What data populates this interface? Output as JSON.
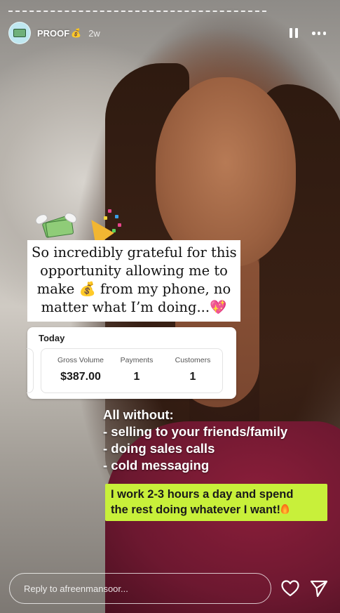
{
  "story": {
    "username": "PROOF",
    "username_emoji": "moneybag-emoji",
    "posted_ago": "2w"
  },
  "caption": {
    "lines": [
      "So incredibly grateful for this",
      "opportunity allowing me to",
      "make 💰 from my phone, no",
      "matter what I’m doing...💖"
    ]
  },
  "dashboard": {
    "title": "Today",
    "stats": [
      {
        "label": "Gross Volume",
        "value": "$387.00"
      },
      {
        "label": "Payments",
        "value": "1"
      },
      {
        "label": "Customers",
        "value": "1"
      }
    ]
  },
  "without_text": [
    "All without:",
    "- selling to your friends/family",
    "- doing sales calls",
    "- cold messaging"
  ],
  "highlight_text": [
    "I work 2-3 hours a day and spend",
    "the rest doing whatever I want!"
  ],
  "reply": {
    "placeholder": "Reply to afreenmansoor..."
  },
  "colors": {
    "highlight": "#c8f03a",
    "avatar_bg": "#bfe7f0"
  }
}
